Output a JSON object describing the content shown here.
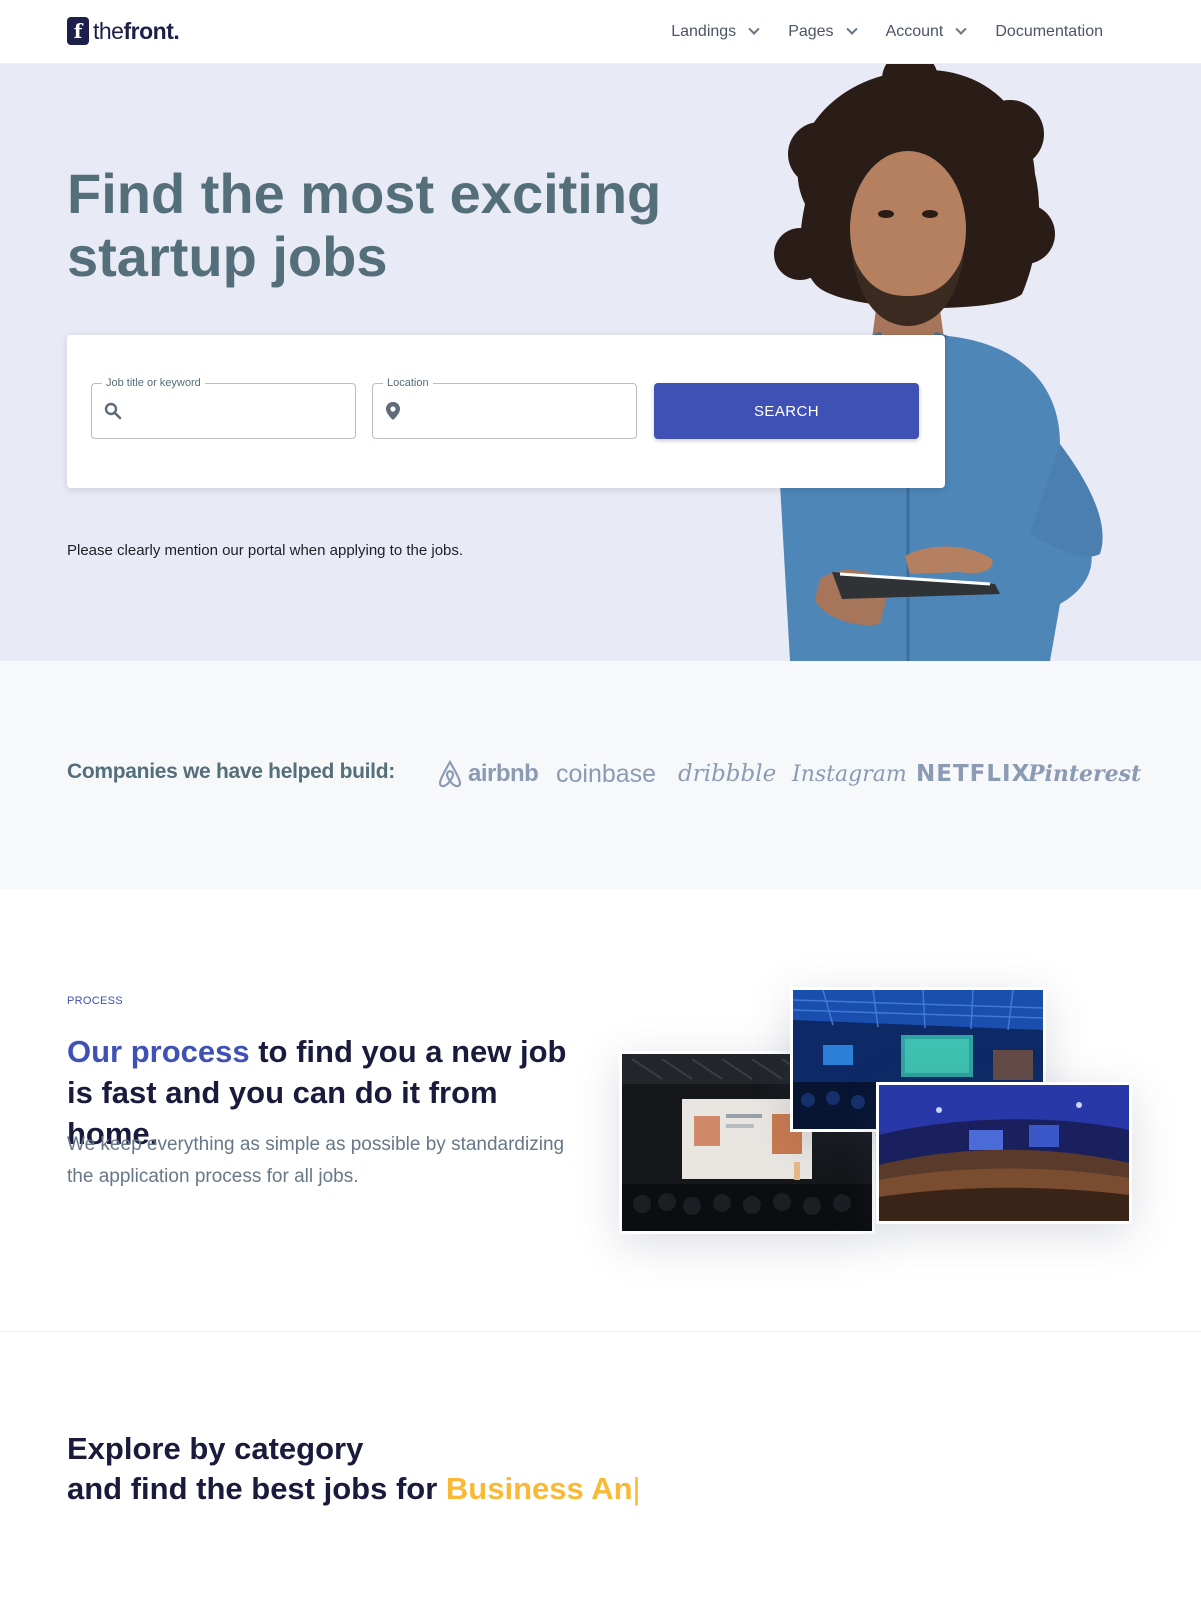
{
  "header": {
    "logo_prefix": "the",
    "logo_suffix": "front.",
    "logo_mark": "f",
    "nav": [
      {
        "label": "Landings",
        "icon": "chevron-down-icon"
      },
      {
        "label": "Pages",
        "icon": "chevron-down-icon"
      },
      {
        "label": "Account",
        "icon": "chevron-down-icon"
      },
      {
        "label": "Documentation"
      }
    ]
  },
  "hero": {
    "title": "Find the most exciting startup jobs",
    "job_field": {
      "label": "Job title or keyword",
      "value": "",
      "icon": "search-icon"
    },
    "location_field": {
      "label": "Location",
      "value": "",
      "icon": "location-pin-icon"
    },
    "search_label": "SEARCH",
    "note": "Please clearly mention our portal when applying to the jobs."
  },
  "companies": {
    "title": "Companies we have helped build:",
    "brands": [
      "airbnb",
      "coinbase",
      "dribbble",
      "Instagram",
      "NETFLIX",
      "Pinterest"
    ]
  },
  "process": {
    "eyebrow": "PROCESS",
    "title_accent": "Our process",
    "title_rest": " to find you a new job is fast and you can do it from home.",
    "subtitle": "We keep everything as simple as possible by standardizing the application process for all jobs."
  },
  "explore": {
    "line1": "Explore by category",
    "line2": "and find the best jobs for ",
    "typed": "Business An",
    "caret": "|"
  },
  "colors": {
    "primary": "#3f51b5",
    "hero_bg": "#e8eaf6",
    "heading_muted": "#546e7a",
    "highlight": "#f9b934",
    "dark_heading": "#1a1b3c"
  }
}
